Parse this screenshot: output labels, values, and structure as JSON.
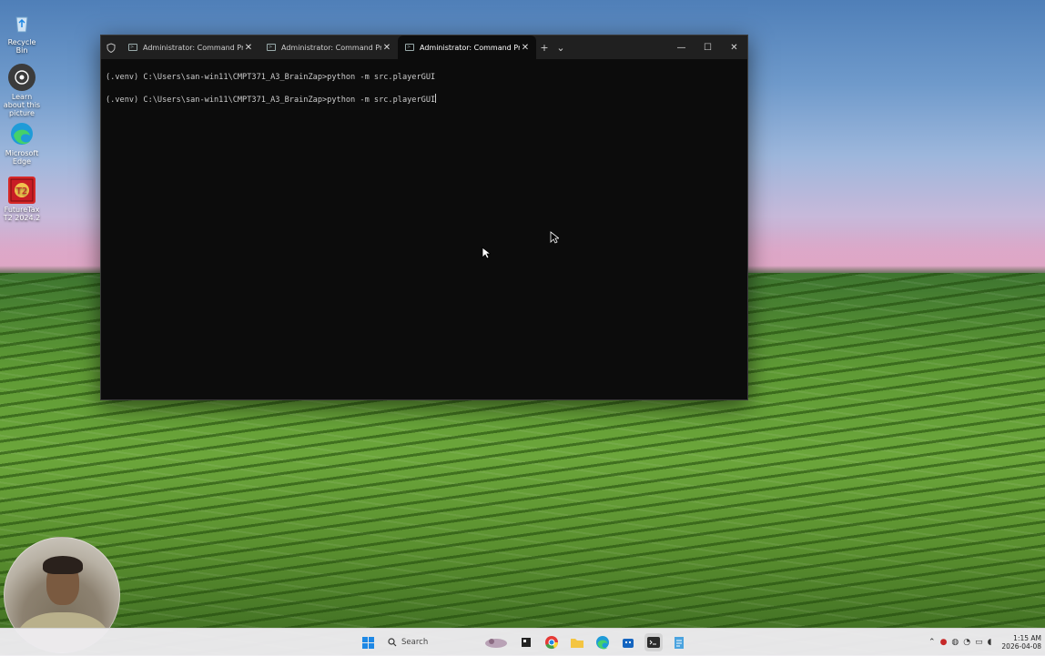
{
  "desktop": {
    "icons": [
      {
        "label": "Recycle Bin",
        "icon": "recycle-bin-icon"
      },
      {
        "label": "Learn about this picture",
        "icon": "camera-lens-icon"
      },
      {
        "label": "Microsoft Edge",
        "icon": "edge-icon"
      },
      {
        "label": "FutureTax T2 2024.2",
        "icon": "t2-tax-icon"
      }
    ]
  },
  "terminal": {
    "tabs": [
      {
        "label": "Administrator: Command Pron",
        "active": false
      },
      {
        "label": "Administrator: Command Pron",
        "active": false
      },
      {
        "label": "Administrator: Command Pro",
        "active": true
      }
    ],
    "new_tab_glyph": "+",
    "dropdown_glyph": "⌄",
    "controls": {
      "minimize": "—",
      "maximize": "☐",
      "close": "✕"
    },
    "lines": [
      "(.venv) C:\\Users\\san-win11\\CMPT371_A3_BrainZap>python -m src.playerGUI",
      "(.venv) C:\\Users\\san-win11\\CMPT371_A3_BrainZap>python -m src.playerGUI"
    ]
  },
  "taskbar": {
    "search_placeholder": "Search",
    "pinned": [
      "widgets-icon",
      "file-explorer-icon",
      "chrome-icon",
      "folder-icon",
      "edge-icon",
      "store-icon",
      "terminal-icon",
      "notepad-icon"
    ],
    "clock": {
      "time": "1:15 AM",
      "date": "2026-04-08"
    }
  },
  "colors": {
    "terminal_bg": "#0c0c0c",
    "titlebar_bg": "#202020",
    "console_text": "#cccccc",
    "taskbar_bg": "#eeecf0",
    "accent": "#1e88e5"
  }
}
